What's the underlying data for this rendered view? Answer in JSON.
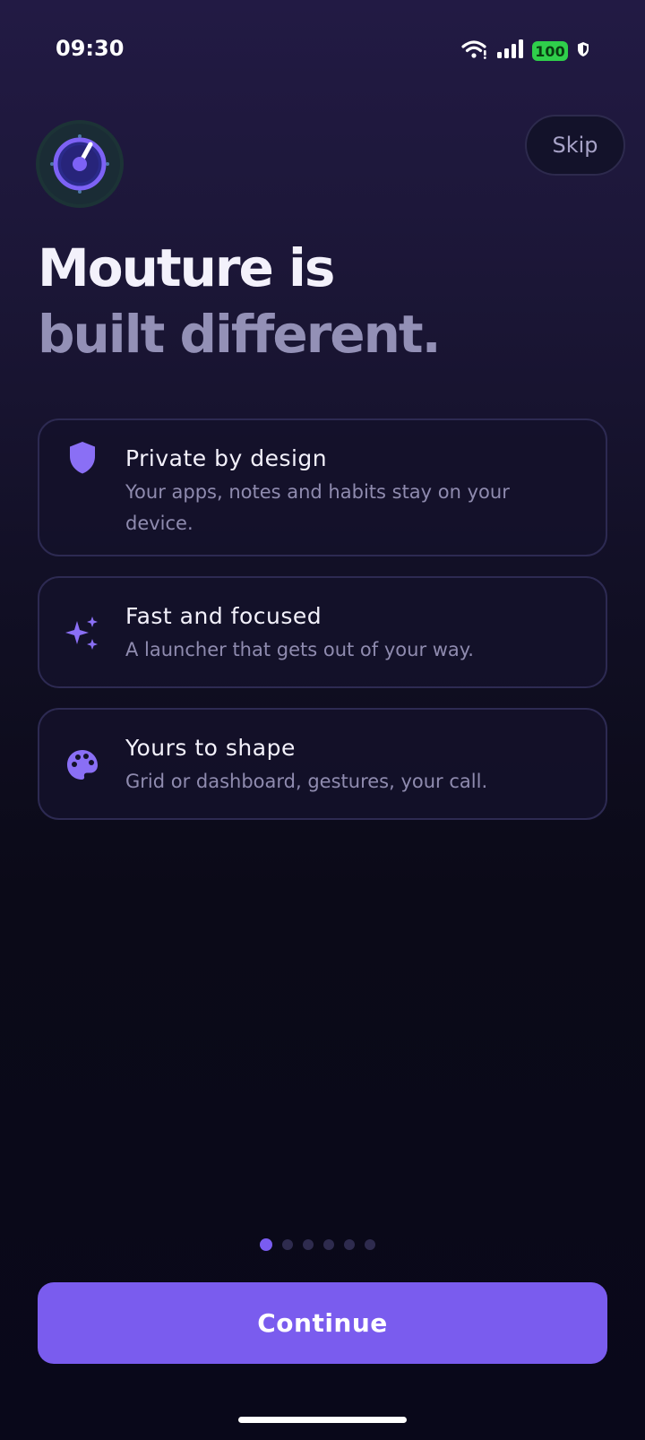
{
  "status_bar": {
    "time": "09:30",
    "battery": "100",
    "battery_color": "#2fcf4b"
  },
  "header": {
    "logo_icon": "speedometer-dial-icon",
    "skip_label": "Skip"
  },
  "headline": {
    "line1": "Mouture is",
    "line2": "built different."
  },
  "features": [
    {
      "icon": "shield-icon",
      "title": "Private by design",
      "description": "Your apps, notes and habits stay on your device."
    },
    {
      "icon": "sparkles-icon",
      "title": "Fast and focused",
      "description": "A launcher that gets out of your way."
    },
    {
      "icon": "palette-icon",
      "title": "Yours to shape",
      "description": "Grid or dashboard, gestures, your call."
    }
  ],
  "pagination": {
    "total": 6,
    "active": 1
  },
  "footer": {
    "continue_label": "Continue"
  },
  "colors": {
    "accent": "#7a5cee",
    "background_top": "#221a44",
    "background_bottom": "#09081a",
    "muted_text": "#8f8baf"
  }
}
